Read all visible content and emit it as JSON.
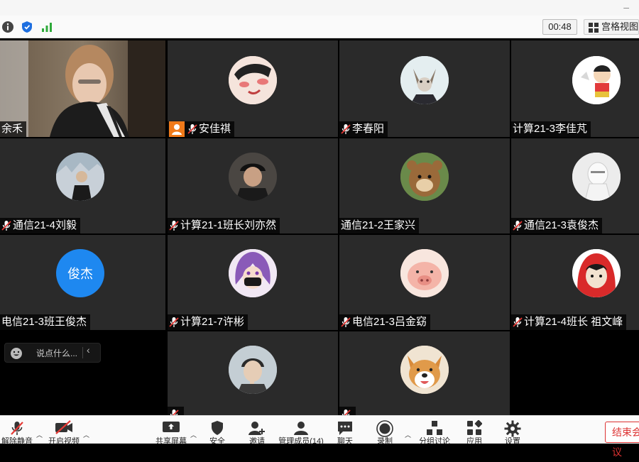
{
  "window": {
    "controls": "–"
  },
  "topbar": {
    "timer": "00:48",
    "grid_view_label": "宫格视图"
  },
  "participants": [
    {
      "name": "余禾",
      "muted": false,
      "video": true
    },
    {
      "name": "安佳祺",
      "muted": true,
      "host": true
    },
    {
      "name": "李春阳",
      "muted": true
    },
    {
      "name": "计算21-3李佳芃",
      "muted": false
    },
    {
      "name": "通信21-4刘毅",
      "muted": true
    },
    {
      "name": "计算21-1班长刘亦然",
      "muted": true
    },
    {
      "name": "通信21-2王家兴",
      "muted": false
    },
    {
      "name": "通信21-3袁俊杰",
      "muted": true
    },
    {
      "name": "电信21-3班王俊杰",
      "muted": false,
      "avatar_text": "俊杰",
      "avatar_color": "#1e88f0"
    },
    {
      "name": "计算21-7许彬",
      "muted": true
    },
    {
      "name": "电信21-3吕金窈",
      "muted": true
    },
    {
      "name": "计算21-4班长 祖文峰",
      "muted": true
    },
    {
      "name": "",
      "muted": true
    },
    {
      "name": "",
      "muted": true
    }
  ],
  "chat": {
    "placeholder": "说点什么..."
  },
  "toolbar": {
    "unmute": "解除静音",
    "start_video": "开启视频",
    "share_screen": "共享屏幕",
    "security": "安全",
    "invite": "邀请",
    "manage_members": "管理成员(14)",
    "chat": "聊天",
    "record": "录制",
    "breakout": "分组讨论",
    "apps": "应用",
    "settings": "设置",
    "end_meeting": "结束会议"
  },
  "colors": {
    "accent": "#1e88f0",
    "end": "#dd3333",
    "host": "#f07a1a",
    "tile_bg": "#2a2a2a"
  }
}
